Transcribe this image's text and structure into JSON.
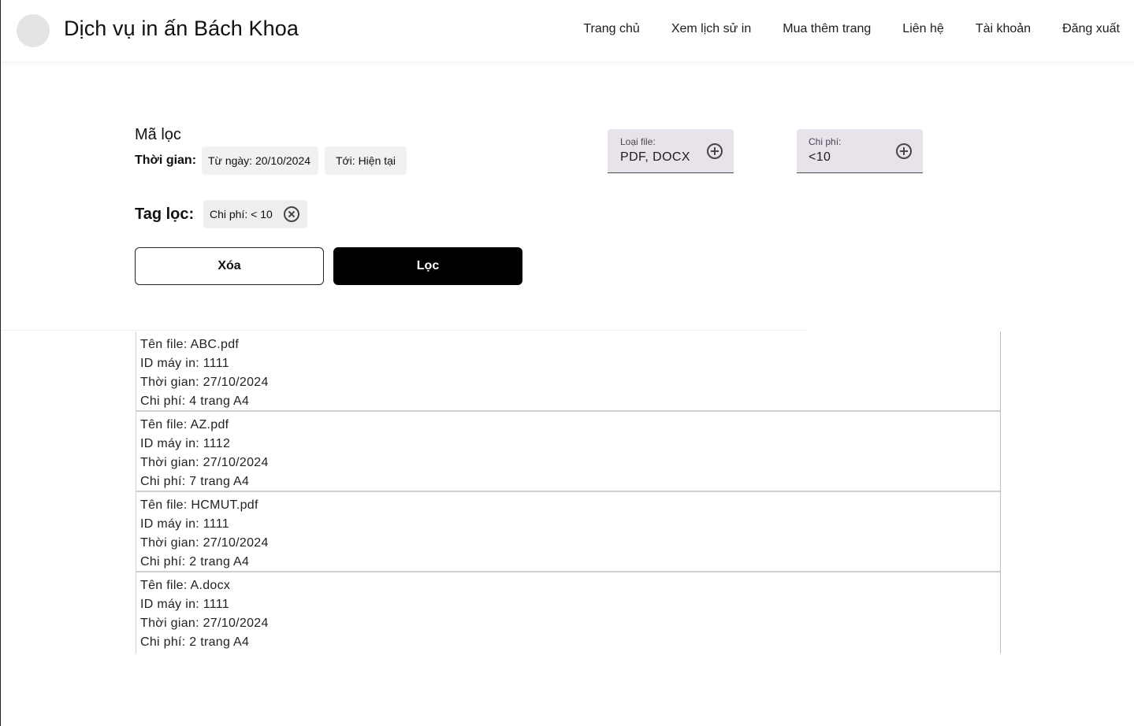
{
  "header": {
    "brand": "Dịch vụ in ấn Bách Khoa",
    "nav": [
      "Trang chủ",
      "Xem lịch sử in",
      "Mua thêm trang",
      "Liên hệ",
      "Tài khoản",
      "Đăng xuất"
    ]
  },
  "filter": {
    "title": "Mã lọc",
    "time_label": "Thời gian:",
    "from_chip": "Từ ngày: 20/10/2024",
    "to_chip": "Tới: Hiện tại",
    "file_type": {
      "label": "Loại file:",
      "value": "PDF, DOCX"
    },
    "cost": {
      "label": "Chi phí:",
      "value": "<10"
    },
    "tag_label": "Tag lọc:",
    "tag_chip": "Chi phí: < 10",
    "clear_label": "Xóa",
    "filter_label": "Lọc"
  },
  "results": [
    {
      "file": "Tên file: ABC.pdf",
      "printer": "ID máy in: 1111",
      "time": "Thời gian: 27/10/2024",
      "cost": "Chi phí: 4 trang A4"
    },
    {
      "file": "Tên file: AZ.pdf",
      "printer": "ID máy in: 1112",
      "time": "Thời gian: 27/10/2024",
      "cost": "Chi phí: 7 trang A4"
    },
    {
      "file": "Tên file: HCMUT.pdf",
      "printer": "ID máy in: 1111",
      "time": "Thời gian: 27/10/2024",
      "cost": "Chi phí: 2 trang A4"
    },
    {
      "file": "Tên file: A.docx",
      "printer": "ID máy in: 1111",
      "time": "Thời gian: 27/10/2024",
      "cost": "Chi phí: 2 trang A4"
    }
  ],
  "colors": {
    "field_bg": "#e8e2ea",
    "primary_button": "#000000",
    "chip_bg": "#f1f1f1"
  },
  "icons": {
    "field_action": "plus-circle-icon",
    "tag_remove": "close-circle-icon"
  }
}
